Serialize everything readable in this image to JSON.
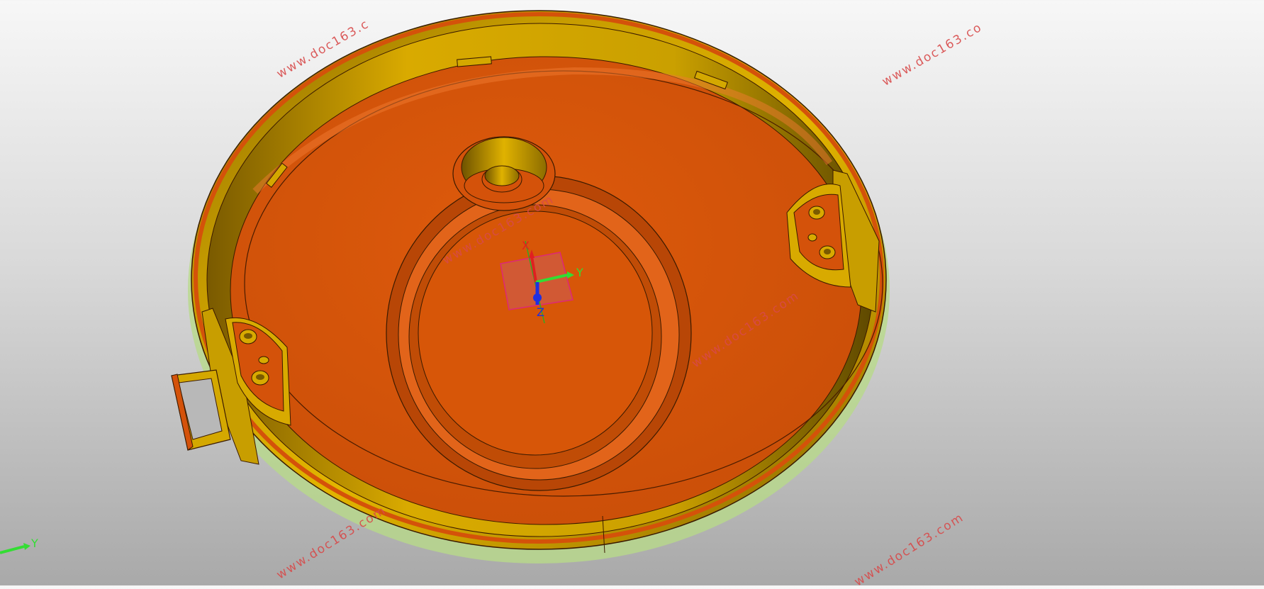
{
  "viewer": {
    "watermark_text": "www.doc163.com",
    "watermark_text_partial_a": "www.doc163.c",
    "watermark_text_partial_b": "www.doc163.co",
    "triad": {
      "x_label": "X",
      "y_label": "Y",
      "z_label": "Z"
    },
    "view_triad": {
      "y_label": "Y"
    }
  },
  "colors": {
    "inner_face": "#d4520a",
    "rim_gold": "#d4a800",
    "rim_dark": "#6a5200",
    "edge_line": "#3a1a00",
    "watermark": "#d84a4a",
    "axis_x": "#e02020",
    "axis_y": "#33dd33",
    "axis_z": "#2030e0"
  }
}
